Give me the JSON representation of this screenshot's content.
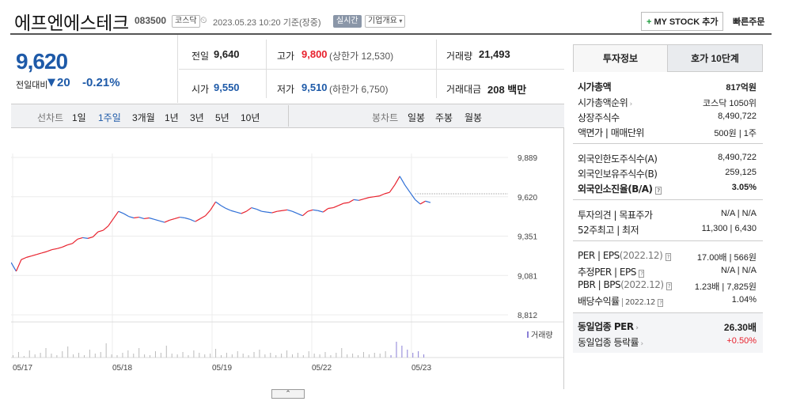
{
  "header": {
    "title": "에프엔에스테크",
    "code": "083500",
    "market_badge": "코스닥",
    "datetime": "2023.05.23 10:20",
    "basis": "기준(장중)",
    "realtime_badge": "실시간",
    "company_overview": "기업개요",
    "my_stock_button": "MY STOCK 추가",
    "quick_order": "빠른주문"
  },
  "price": {
    "current": "9,620",
    "diff_label": "전일대비",
    "diff_value": "20",
    "diff_pct": "-0.21%"
  },
  "stats": {
    "prev_close_label": "전일",
    "prev_close": "9,640",
    "high_label": "고가",
    "high": "9,800",
    "high_limit": "(상한가 12,530)",
    "volume_label": "거래량",
    "volume": "21,493",
    "open_label": "시가",
    "open": "9,550",
    "low_label": "저가",
    "low": "9,510",
    "low_limit": "(하한가 6,750)",
    "amount_label": "거래대금",
    "amount": "208 백만"
  },
  "period_bar": {
    "line_label": "선차트",
    "periods": [
      "1일",
      "1주일",
      "3개월",
      "1년",
      "3년",
      "5년",
      "10년"
    ],
    "selected_period": "1주일",
    "candle_label": "봉차트",
    "candles": [
      "일봉",
      "주봉",
      "월봉"
    ]
  },
  "chart_data": {
    "type": "line",
    "y_ticks": [
      "9,889",
      "9,620",
      "9,351",
      "9,081",
      "8,812"
    ],
    "x_ticks": [
      "05/17",
      "05/18",
      "05/19",
      "05/22",
      "05/23"
    ],
    "ylim": [
      8812,
      9889
    ],
    "prev_close": 9640,
    "volume_label": "거래량",
    "up_color": "#e8212d",
    "down_color": "#2f6fd6",
    "series": [
      {
        "values": [
          9170,
          9110,
          9190,
          9205,
          9215,
          9225,
          9235,
          9245,
          9258,
          9265,
          9275,
          9290,
          9300,
          9330,
          9340,
          9335,
          9345,
          9380,
          9390,
          9420,
          9470,
          9520,
          9505,
          9485,
          9475,
          9480,
          9470,
          9475,
          9465,
          9455,
          9445,
          9460,
          9470,
          9480,
          9475,
          9465,
          9450,
          9470,
          9490,
          9530,
          9585,
          9560,
          9540,
          9525,
          9515,
          9505,
          9520,
          9545,
          9535,
          9520,
          9515,
          9510,
          9520,
          9525,
          9530,
          9520,
          9505,
          9490,
          9520,
          9530,
          9525,
          9515,
          9540,
          9545,
          9560,
          9575,
          9580,
          9600,
          9595,
          9605,
          9615,
          9620,
          9625,
          9640,
          9650,
          9700,
          9760,
          9700,
          9650,
          9600,
          9570,
          9590,
          9580
        ]
      }
    ]
  },
  "tabs": [
    "투자정보",
    "호가 10단계"
  ],
  "invest_info": {
    "market_cap_label": "시가총액",
    "market_cap": "817억원",
    "market_cap_rank_label": "시가총액순위",
    "market_cap_rank": "코스닥 1050위",
    "shares_label": "상장주식수",
    "shares": "8,490,722",
    "par_label": "액면가 | 매매단위",
    "par": "500원 | 1주",
    "foreign_limit_label": "외국인한도주식수(A)",
    "foreign_limit": "8,490,722",
    "foreign_hold_label": "외국인보유주식수(B)",
    "foreign_hold": "259,125",
    "foreign_ratio_label": "외국인소진율(B/A)",
    "foreign_ratio": "3.05%",
    "opinion_label": "투자의견 | 목표주가",
    "opinion": "N/A | N/A",
    "range52_label": "52주최고 | 최저",
    "range52": "11,300 | 6,430",
    "per_label": "PER | EPS",
    "per_year": "(2022.12)",
    "per": "17.00배 | 566원",
    "est_per_label": "추정PER | EPS",
    "est_per": "N/A | N/A",
    "pbr_label": "PBR | BPS",
    "pbr_year": "(2022.12)",
    "pbr": "1.23배 | 7,825원",
    "dividend_label": "배당수익률",
    "dividend_year": "2022.12",
    "dividend": "1.04%",
    "peer_per_label": "동일업종 PER",
    "peer_per": "26.30배",
    "peer_rate_label": "동일업종 등락률",
    "peer_rate": "+0.50%"
  }
}
